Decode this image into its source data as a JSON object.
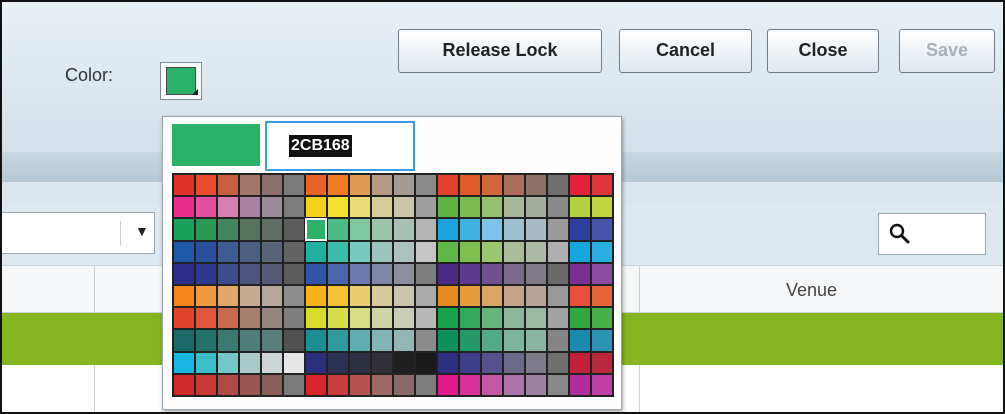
{
  "color_field": {
    "label": "Color:",
    "value_hex": "#2CB168"
  },
  "buttons": {
    "release_lock": "Release Lock",
    "cancel": "Cancel",
    "close": "Close",
    "save": "Save"
  },
  "grid": {
    "venue_header": "Venue"
  },
  "color_picker": {
    "hex_input": "2CB168",
    "selected_color": "#2CB168",
    "selected_cell": {
      "row": 2,
      "col": 6
    },
    "palette": [
      [
        "#e0302a",
        "#e84b2d",
        "#c95d3f",
        "#a3766c",
        "#8a6f6c",
        "#7a7a7a",
        "#e8622a",
        "#f07c24",
        "#e09a55",
        "#b59a86",
        "#a49a92",
        "#8a8a8a",
        "#e3402b",
        "#e05a2a",
        "#d3663a",
        "#ad6d5d",
        "#8e7068",
        "#6e6e6e",
        "#e3223a",
        "#e0363a",
        "#ce4e4e",
        "#aa6b6b",
        "#8a6a6a",
        "#5a5a5a"
      ],
      [
        "#e82f8e",
        "#e54fa0",
        "#d67fb0",
        "#a882a0",
        "#9b8b98",
        "#7c7c7c",
        "#f6d11c",
        "#f5e030",
        "#eedc7a",
        "#d6cb9a",
        "#cdc6ad",
        "#9d9d9d",
        "#5cb242",
        "#7cbc4e",
        "#96c06e",
        "#a6b79a",
        "#a4ad9e",
        "#898989",
        "#b3d23d",
        "#c1d53e",
        "#cfd87a",
        "#c7ccaa",
        "#c2c6b8",
        "#b5b5b5"
      ],
      [
        "#1aa15a",
        "#2c9a57",
        "#43865d",
        "#55725f",
        "#5f6b63",
        "#5b5b5b",
        "#2cb168",
        "#4cbb84",
        "#7fc89f",
        "#9dc4ad",
        "#a7c1b3",
        "#b4b4b4",
        "#1ca4dc",
        "#3fb2e2",
        "#7dc5e6",
        "#9ec0d0",
        "#a9bcc6",
        "#9a9a9a",
        "#2e3fa2",
        "#4654aa",
        "#6a74a8",
        "#7a7f9e",
        "#838697",
        "#7d7d7d"
      ],
      [
        "#1e58a6",
        "#2b4fa1",
        "#3f5c95",
        "#4d5f80",
        "#5a6378",
        "#626262",
        "#20b0a0",
        "#3dbbaa",
        "#76c9bd",
        "#9dc4bd",
        "#abc2be",
        "#c6c6c6",
        "#5fb744",
        "#81bf4e",
        "#9ac76f",
        "#a9bb98",
        "#adb8a6",
        "#b0b0b0",
        "#17a7e0",
        "#2aaee2",
        "#63c2e6",
        "#8ab9cf",
        "#9fb8c4",
        "#a5a5a5"
      ],
      [
        "#2c2e8a",
        "#2f3a8f",
        "#3e4b8c",
        "#4c5480",
        "#565a78",
        "#5c5c5c",
        "#3253a6",
        "#4b65ad",
        "#6a78b0",
        "#7f86a6",
        "#8a8e9e",
        "#7e7e7e",
        "#4b2a88",
        "#5d3a8e",
        "#6f4f90",
        "#7a6a8c",
        "#807a88",
        "#6a6a6a",
        "#7a2e96",
        "#8d4aa1",
        "#9d6aa8",
        "#9c87a4",
        "#9a8fa0",
        "#838383"
      ],
      [
        "#f5871f",
        "#f19a3d",
        "#e0a66a",
        "#c7a994",
        "#b6a79b",
        "#8c8c8c",
        "#f8b31a",
        "#f5c134",
        "#eccc73",
        "#d8c99d",
        "#cdc4ae",
        "#aaaaaa",
        "#e78a20",
        "#e59a3c",
        "#d9a564",
        "#c4a488",
        "#b8a497",
        "#999999",
        "#e8503a",
        "#e8653a",
        "#dd7a55",
        "#c38d78",
        "#b3918a",
        "#8f8f8f"
      ],
      [
        "#e2452a",
        "#e0563a",
        "#c86a4d",
        "#a57e6e",
        "#94857f",
        "#7f7f7f",
        "#d8dc2d",
        "#d7df4b",
        "#d8df85",
        "#cfd4a8",
        "#c9ccb6",
        "#b8b8b8",
        "#19a14b",
        "#32a85a",
        "#64b67e",
        "#8eb79b",
        "#9bb8a4",
        "#a2a2a2",
        "#2ea83f",
        "#47b24c",
        "#74bd6c",
        "#96bd90",
        "#a1bc9c",
        "#9e9e9e"
      ],
      [
        "#1a6a6a",
        "#23716b",
        "#3a7a73",
        "#4e7c76",
        "#59807a",
        "#515151",
        "#1b8e94",
        "#2f999c",
        "#5eadb0",
        "#83b5b6",
        "#92b6b6",
        "#8b8b8b",
        "#0f8f5c",
        "#24996a",
        "#52ab86",
        "#7cb59c",
        "#8ab5a2",
        "#858585",
        "#1b8ab1",
        "#2c92b4",
        "#5ea8c1",
        "#84b0bf",
        "#93b2bd",
        "#7b7b7b"
      ],
      [
        "#18b7e2",
        "#3abfc7",
        "#73c7c9",
        "#a9c9c9",
        "#cdd6d6",
        "#e6e6e6",
        "#2a2e7c",
        "#2b3152",
        "#2d2f42",
        "#303036",
        "#1f1f1f",
        "#1a1a1a",
        "#2d2f82",
        "#3e3f8a",
        "#55528e",
        "#6b6a8a",
        "#7d7a89",
        "#707070",
        "#c2203a",
        "#b8293e",
        "#a54049",
        "#8c5258",
        "#75565a",
        "#464646"
      ],
      [
        "#d22a2a",
        "#c93a36",
        "#b04a44",
        "#9a5752",
        "#8a5e5a",
        "#7a7a7a",
        "#d8252d",
        "#c83c3c",
        "#b45450",
        "#a06864",
        "#8d6a67",
        "#7d7d7d",
        "#e01a8a",
        "#d8329a",
        "#c458a6",
        "#ad73a8",
        "#9c80a2",
        "#888888",
        "#b02c9e",
        "#c040a8",
        "#c86ab4",
        "#b98cb4",
        "#a594ac",
        "#e81e2c"
      ]
    ]
  },
  "colors": {
    "header_bg": "#dde8ef",
    "row_highlight": "#86b522",
    "focus_border": "#3a9be6"
  }
}
